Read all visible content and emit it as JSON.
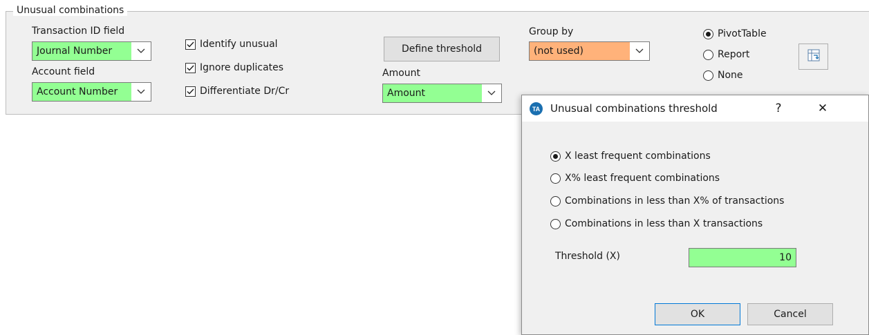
{
  "panel": {
    "title": "Unusual combinations",
    "transaction_id": {
      "label": "Transaction ID field",
      "value": "Journal Number"
    },
    "account": {
      "label": "Account field",
      "value": "Account Number"
    },
    "checkboxes": [
      {
        "label": "Identify unusual",
        "checked": true
      },
      {
        "label": "Ignore duplicates",
        "checked": true
      },
      {
        "label": "Differentiate Dr/Cr",
        "checked": true
      }
    ],
    "define_threshold_label": "Define threshold",
    "amount": {
      "label": "Amount",
      "value": "Amount"
    },
    "group_by": {
      "label": "Group by",
      "value": "(not used)"
    },
    "output_options": [
      {
        "label": "PivotTable",
        "selected": true
      },
      {
        "label": "Report",
        "selected": false
      },
      {
        "label": "None",
        "selected": false
      }
    ],
    "icon": "swap-layout-icon"
  },
  "dialog": {
    "title": "Unusual combinations threshold",
    "help_label": "?",
    "close_label": "✕",
    "app_icon_text": "TA",
    "options": [
      {
        "label": "X least frequent combinations",
        "selected": true
      },
      {
        "label": "X% least frequent combinations",
        "selected": false
      },
      {
        "label": "Combinations in less than X% of transactions",
        "selected": false
      },
      {
        "label": "Combinations in less than X transactions",
        "selected": false
      }
    ],
    "threshold_label": "Threshold (X)",
    "threshold_value": "10",
    "ok_label": "OK",
    "cancel_label": "Cancel"
  },
  "colors": {
    "field_green": "#93ff93",
    "field_orange": "#ffb27a",
    "panel_bg": "#f0f0f0",
    "icon_blue": "#1a6fb0"
  }
}
